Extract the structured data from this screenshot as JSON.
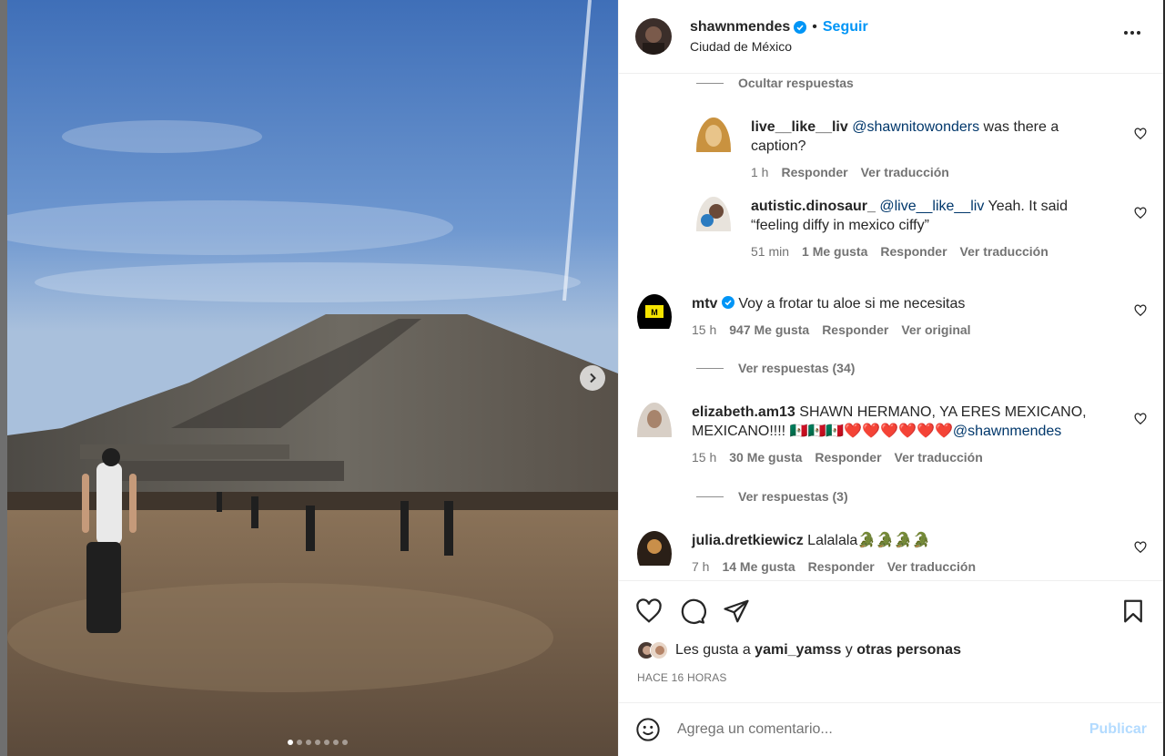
{
  "post": {
    "username": "shawnmendes",
    "separator": "•",
    "follow_label": "Seguir",
    "location": "Ciudad de México",
    "media_slide_count": 7,
    "media_active_index": 0
  },
  "comments": {
    "hide_replies_label": "Ocultar respuestas",
    "replies": [
      {
        "user": "live__like__liv",
        "mention": "@shawnitowonders",
        "text": " was there a caption?",
        "time": "1 h",
        "reply_label": "Responder",
        "translate_label": "Ver traducción"
      },
      {
        "user": "autistic.dinosaur_",
        "mention": "@live__like__liv",
        "text": " Yeah. It said “feeling diffy in mexico ciffy”",
        "time": "51 min",
        "likes": "1 Me gusta",
        "reply_label": "Responder",
        "translate_label": "Ver traducción"
      }
    ],
    "top_level": [
      {
        "user": "mtv",
        "verified": true,
        "text": "Voy a frotar tu aloe si me necesitas",
        "time": "15 h",
        "likes": "947 Me gusta",
        "reply_label": "Responder",
        "translate_label": "Ver original",
        "view_replies": "Ver respuestas (34)"
      },
      {
        "user": "elizabeth.am13",
        "text": "SHAWN HERMANO, YA ERES MEXICANO, MEXICANO!!!! 🇲🇽🇲🇽🇲🇽❤️❤️❤️❤️❤️❤️",
        "mention": "@shawnmendes",
        "time": "15 h",
        "likes": "30 Me gusta",
        "reply_label": "Responder",
        "translate_label": "Ver traducción",
        "view_replies": "Ver respuestas (3)"
      },
      {
        "user": "julia.dretkiewicz",
        "text": "Lalalala🐊🐊🐊🐊",
        "time": "7 h",
        "likes": "14 Me gusta",
        "reply_label": "Responder",
        "translate_label": "Ver traducción"
      }
    ]
  },
  "likes_summary": {
    "prefix": "Les gusta a ",
    "user": "yami_yamss",
    "connector": " y ",
    "others": "otras personas"
  },
  "posted_ago": "HACE 16 HORAS",
  "add_comment": {
    "placeholder": "Agrega un comentario...",
    "publish_label": "Publicar"
  },
  "colors": {
    "accent": "#0095f6",
    "verified": "#0095f6",
    "mention": "#00376b",
    "muted": "#737373",
    "publish_disabled": "#b3dbff"
  }
}
